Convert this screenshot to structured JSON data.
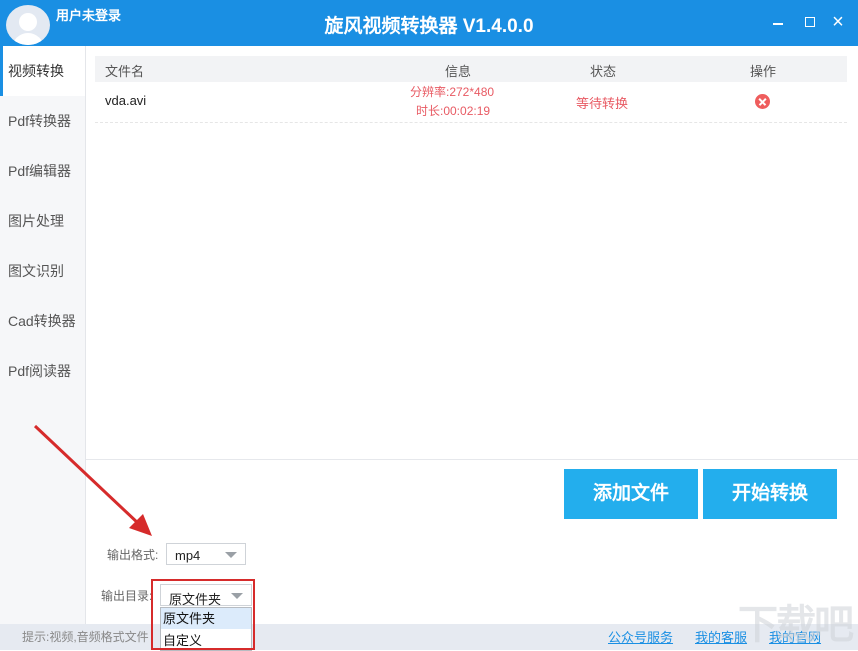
{
  "header": {
    "user_label": "用户未登录",
    "title": "旋风视频转换器 V1.4.0.0"
  },
  "window_controls": {
    "close_glyph": "×"
  },
  "sidebar": {
    "items": [
      {
        "label": "视频转换",
        "active": true
      },
      {
        "label": "Pdf转换器"
      },
      {
        "label": "Pdf编辑器"
      },
      {
        "label": "图片处理"
      },
      {
        "label": "图文识别"
      },
      {
        "label": "Cad转换器"
      },
      {
        "label": "Pdf阅读器"
      }
    ]
  },
  "table": {
    "columns": {
      "name": "文件名",
      "info": "信息",
      "status": "状态",
      "action": "操作"
    },
    "rows": [
      {
        "name": "vda.avi",
        "resolution": "分辨率:272*480",
        "duration": "时长:00:02:19",
        "status": "等待转换"
      }
    ]
  },
  "actions": {
    "add_file": "添加文件",
    "start": "开始转换"
  },
  "output": {
    "format_label": "输出格式:",
    "format_value": "mp4",
    "dir_label": "输出目录:",
    "dir_value": "原文件夹",
    "dir_options": [
      "原文件夹",
      "自定义"
    ]
  },
  "footer": {
    "tip": "提示:视频,音频格式文件",
    "links": [
      "公众号服务",
      "我的客服",
      "我的官网"
    ],
    "watermark": "下载吧"
  },
  "colors": {
    "brand": "#1a8fe3",
    "button": "#23aeed",
    "status_red": "#e85a63",
    "highlight": "#d62b2b"
  }
}
